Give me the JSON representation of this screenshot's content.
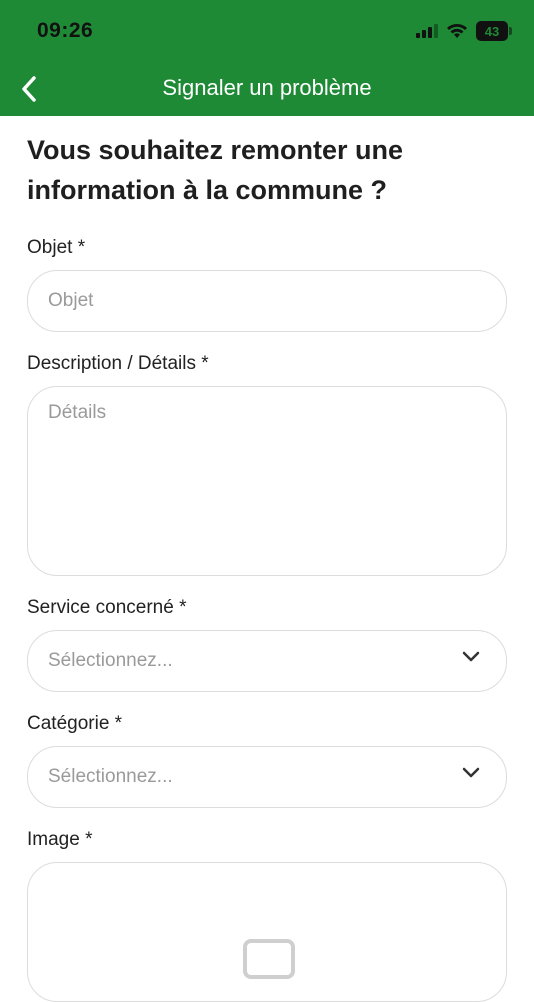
{
  "status_bar": {
    "time": "09:26",
    "battery": "43"
  },
  "nav": {
    "title": "Signaler un problème"
  },
  "page": {
    "title": "Vous souhaitez remonter une information à la commune ?"
  },
  "form": {
    "object": {
      "label": "Objet *",
      "placeholder": "Objet"
    },
    "description": {
      "label": "Description / Détails *",
      "placeholder": "Détails"
    },
    "service": {
      "label": "Service concerné *",
      "placeholder": "Sélectionnez..."
    },
    "category": {
      "label": "Catégorie *",
      "placeholder": "Sélectionnez..."
    },
    "image": {
      "label": "Image *"
    }
  },
  "colors": {
    "brand_green": "#1f8a36",
    "field_border": "#dcdcdc",
    "placeholder": "#9a9a9a"
  },
  "icons": [
    "back-chevron-icon",
    "signal-icon",
    "wifi-icon",
    "battery-icon",
    "chevron-down-icon",
    "image-placeholder-icon"
  ]
}
